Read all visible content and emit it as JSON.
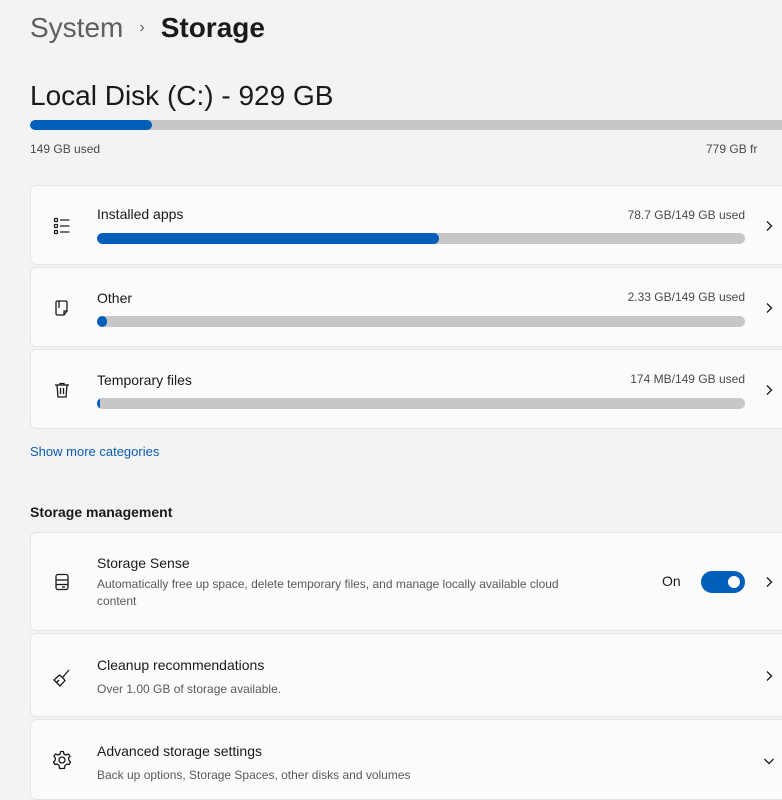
{
  "breadcrumb": {
    "parent": "System",
    "separator": "›",
    "current": "Storage"
  },
  "disk": {
    "title": "Local Disk (C:) - 929 GB",
    "used_label": "149 GB used",
    "free_label": "779 GB fr",
    "used_fraction": 0.16
  },
  "categories": [
    {
      "icon": "apps-list-icon",
      "title": "Installed apps",
      "usage": "78.7 GB/149 GB used",
      "fraction": 0.528
    },
    {
      "icon": "other-files-icon",
      "title": "Other",
      "usage": "2.33 GB/149 GB used",
      "fraction": 0.016
    },
    {
      "icon": "trash-icon",
      "title": "Temporary files",
      "usage": "174 MB/149 GB used",
      "fraction": 0.002
    }
  ],
  "show_more_label": "Show more categories",
  "storage_management": {
    "heading": "Storage management",
    "storage_sense": {
      "title": "Storage Sense",
      "description": "Automatically free up space, delete temporary files, and manage locally available cloud content",
      "toggle_label": "On",
      "toggle_on": true
    },
    "cleanup": {
      "title": "Cleanup recommendations",
      "description": "Over 1.00 GB of storage available."
    },
    "advanced": {
      "title": "Advanced storage settings",
      "description": "Back up options, Storage Spaces, other disks and volumes"
    }
  },
  "colors": {
    "accent": "#005fb8",
    "track": "#c7c7c7",
    "link": "#0a5cb5"
  }
}
